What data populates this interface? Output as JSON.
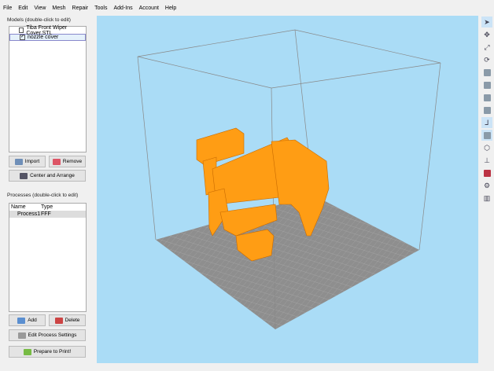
{
  "menu": [
    "File",
    "Edit",
    "View",
    "Mesh",
    "Repair",
    "Tools",
    "Add-Ins",
    "Account",
    "Help"
  ],
  "models": {
    "title": "Models (double-click to edit)",
    "items": [
      {
        "name": "Tiba Front Wiper Cover.STL",
        "checked": false
      },
      {
        "name": "nozzle cover",
        "checked": true
      }
    ],
    "import": "Import",
    "remove": "Remove",
    "center": "Center and Arrange"
  },
  "processes": {
    "title": "Processes (double-click to edit)",
    "headers": [
      "Name",
      "Type"
    ],
    "rows": [
      [
        "Process1",
        "FFF"
      ]
    ],
    "add": "Add",
    "delete": "Delete",
    "edit": "Edit Process Settings",
    "prepare": "Prepare to Print!"
  },
  "toolbar": [
    "select-icon",
    "move-icon",
    "scale-icon",
    "rotate-icon",
    "view-front-icon",
    "view-top-icon",
    "view-side-icon",
    "view-iso-icon",
    "axes-icon",
    "solid-view-icon",
    "wireframe-icon",
    "build-table-icon",
    "cross-section-icon",
    "settings-icon",
    "supports-icon"
  ],
  "colors": {
    "viewport": "#aadcf6",
    "model": "#ff9d14",
    "floor": "#8e8e8e"
  }
}
